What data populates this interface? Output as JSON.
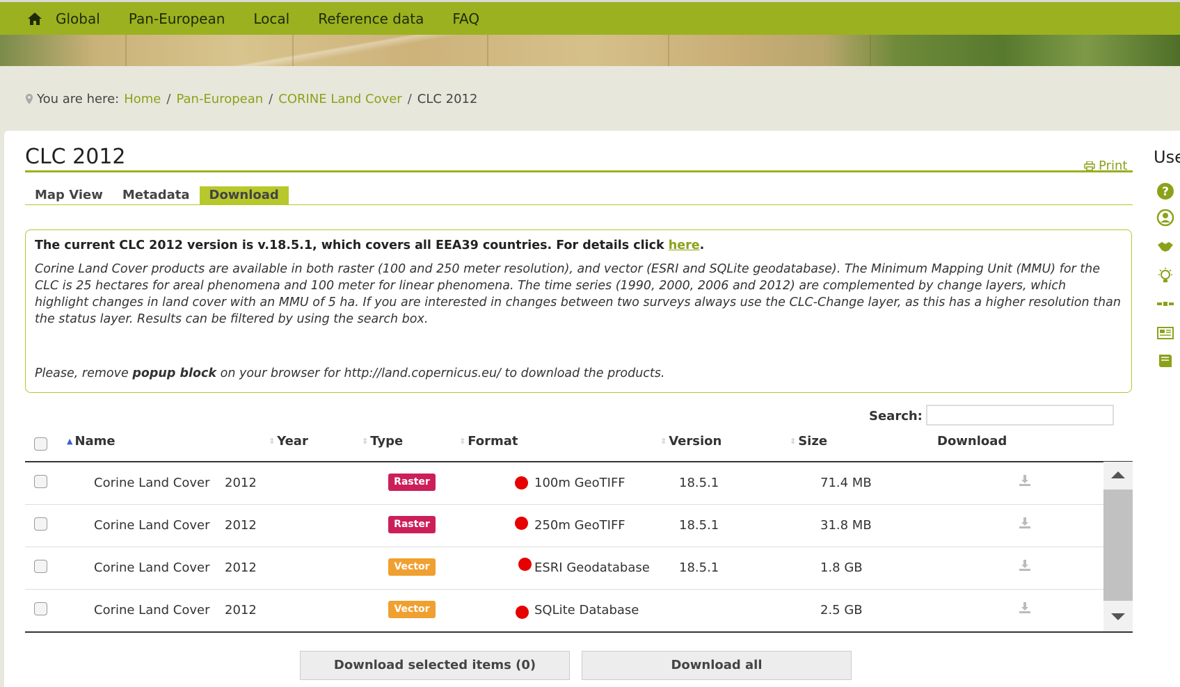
{
  "nav": {
    "items": [
      "Global",
      "Pan-European",
      "Local",
      "Reference data",
      "FAQ"
    ]
  },
  "breadcrumb": {
    "prefix": "You are here:",
    "links": [
      "Home",
      "Pan-European",
      "CORINE Land Cover"
    ],
    "current": "CLC 2012"
  },
  "page": {
    "title": "CLC 2012",
    "print": "Print",
    "tabs": [
      "Map View",
      "Metadata",
      "Download"
    ],
    "active_tab": "Download"
  },
  "info": {
    "head": "The current CLC 2012 version is v.18.5.1, which covers all EEA39 countries. For details click ",
    "head_link": "here",
    "head_end": ".",
    "body": "Corine Land Cover products are available in both raster (100 and 250 meter resolution), and vector (ESRI and SQLite geodatabase). The Minimum Mapping Unit (MMU) for the CLC is 25 hectares for areal phenomena and 100 meter for linear phenomena. The time series (1990, 2000, 2006 and 2012) are complemented by change layers, which highlight changes in land cover with an MMU of 5 ha. If you are interested in changes between two surveys always use the CLC-Change layer, as this has a higher resolution than the status layer. Results can be filtered by using the search box.",
    "popup_pre": "Please, remove ",
    "popup_bold": "popup block",
    "popup_post": " on your browser for http://land.copernicus.eu/ to download the products."
  },
  "search": {
    "label": "Search:",
    "value": ""
  },
  "table": {
    "headers": {
      "name": "Name",
      "year": "Year",
      "type": "Type",
      "format": "Format",
      "version": "Version",
      "size": "Size",
      "download": "Download"
    },
    "rows": [
      {
        "name": "Corine Land Cover",
        "year": "2012",
        "type": "Raster",
        "format": "100m GeoTIFF",
        "version": "18.5.1",
        "size": "71.4 MB"
      },
      {
        "name": "Corine Land Cover",
        "year": "2012",
        "type": "Raster",
        "format": "250m GeoTIFF",
        "version": "18.5.1",
        "size": "31.8 MB"
      },
      {
        "name": "Corine Land Cover",
        "year": "2012",
        "type": "Vector",
        "format": "ESRI Geodatabase",
        "version": "18.5.1",
        "size": "1.8 GB"
      },
      {
        "name": "Corine Land Cover",
        "year": "2012",
        "type": "Vector",
        "format": "SQLite Database",
        "version": "",
        "size": "2.5 GB"
      }
    ]
  },
  "buttons": {
    "download_selected": "Download selected items (0)",
    "download_all": "Download all"
  },
  "sidebar": {
    "title": "Use"
  },
  "colors": {
    "brand": "#9bb11f",
    "link": "#8aa21a",
    "raster": "#cc1f5a",
    "vector": "#f0a030",
    "status_dot": "#e60000"
  }
}
